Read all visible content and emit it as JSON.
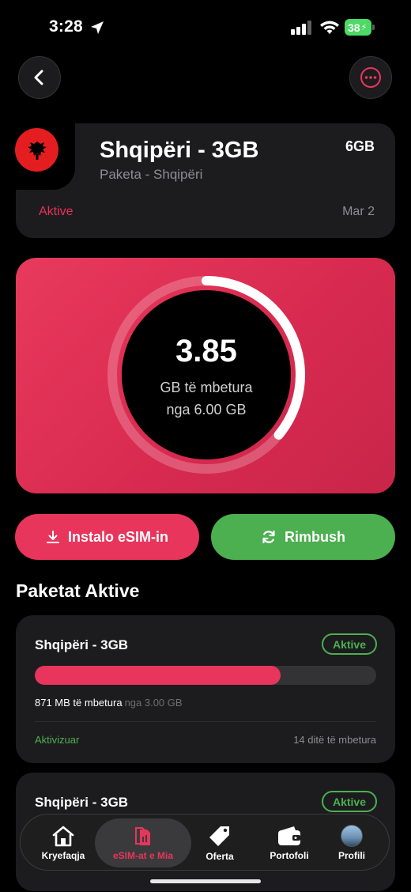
{
  "status_bar": {
    "time": "3:28",
    "battery": "38"
  },
  "plan": {
    "title": "Shqipëri - 3GB",
    "subtitle": "Paketa - Shqipëri",
    "size": "6GB",
    "status": "Aktive",
    "date": "Mar 2"
  },
  "gauge": {
    "value": "3.85",
    "label": "GB të mbetura",
    "total": "nga 6.00 GB",
    "remaining_fraction": 0.36
  },
  "actions": {
    "install_label": "Instalo eSIM-in",
    "recharge_label": "Rimbush"
  },
  "section_title": "Paketat Aktive",
  "packages": [
    {
      "name": "Shqipëri - 3GB",
      "badge": "Aktive",
      "remaining": "871 MB të mbetura",
      "of_total": "nga 3.00 GB",
      "used_fraction": 0.72,
      "activated": "Aktivizuar",
      "days_left": "14 ditë të mbetura"
    },
    {
      "name": "Shqipëri - 3GB",
      "badge": "Aktive"
    }
  ],
  "tabbar": {
    "home": "Kryefaqja",
    "esim": "eSIM-at e Mia",
    "offers": "Oferta",
    "wallet": "Portofoli",
    "profile": "Profili"
  },
  "colors": {
    "accent": "#e8355b",
    "success": "#4caf50"
  }
}
